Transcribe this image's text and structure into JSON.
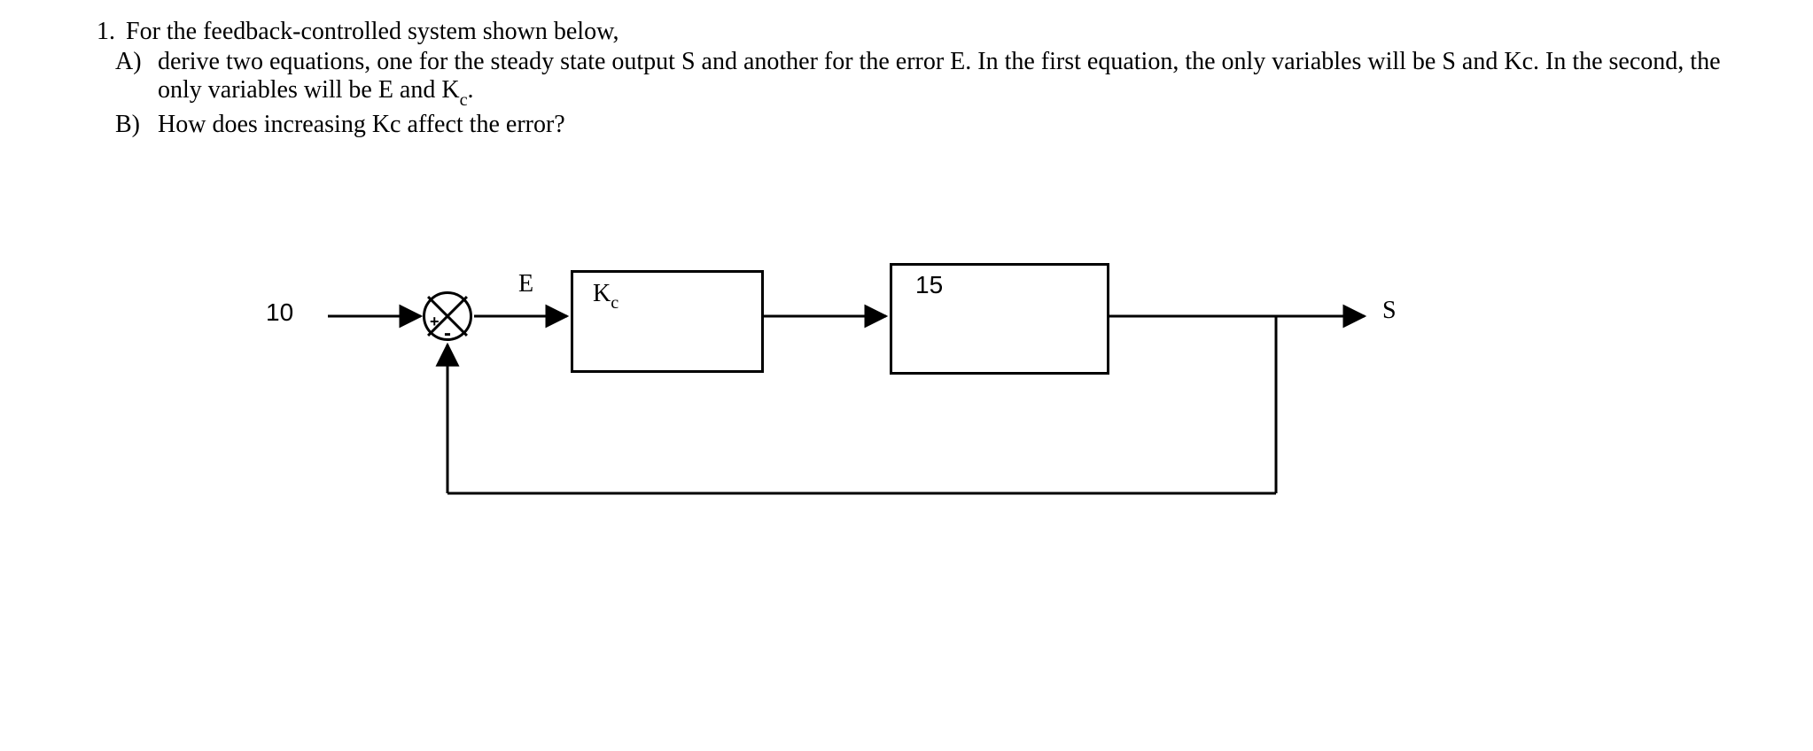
{
  "question": {
    "number": "1.",
    "stem": "For the feedback-controlled system shown below,",
    "parts": [
      {
        "marker": "A)",
        "text_html": "derive two equations, one for the steady state output S and another for the error E. In the first equation, the only variables will be S and Kc. In  the second, the only variables will be E and K<span class='sub-c'>c</span>."
      },
      {
        "marker": "B)",
        "text_html": "How does increasing Kc affect the error?"
      }
    ]
  },
  "diagram": {
    "input_label": "10",
    "error_label": "E",
    "controller_label_html": "K<span class='sub-c'>c</span>",
    "process_label": "15",
    "output_label": "S",
    "summer_plus": "+",
    "summer_minus": "-"
  },
  "chart_data": {
    "type": "block-diagram",
    "nodes": [
      {
        "id": "ref",
        "kind": "source",
        "value": 10
      },
      {
        "id": "sum",
        "kind": "summer",
        "inputs": [
          {
            "sign": "+",
            "from": "ref"
          },
          {
            "sign": "-",
            "from": "feedback"
          }
        ],
        "output_label": "E"
      },
      {
        "id": "ctrl",
        "kind": "gain",
        "label": "Kc"
      },
      {
        "id": "proc",
        "kind": "gain",
        "label": "15",
        "value": 15
      },
      {
        "id": "out",
        "kind": "sink",
        "label": "S"
      }
    ],
    "edges": [
      {
        "from": "ref",
        "to": "sum"
      },
      {
        "from": "sum",
        "to": "ctrl",
        "label": "E"
      },
      {
        "from": "ctrl",
        "to": "proc"
      },
      {
        "from": "proc",
        "to": "out",
        "branch": "feedback"
      },
      {
        "from": "feedback",
        "to": "sum"
      }
    ],
    "feedback": {
      "type": "unity",
      "sign": "-"
    }
  }
}
